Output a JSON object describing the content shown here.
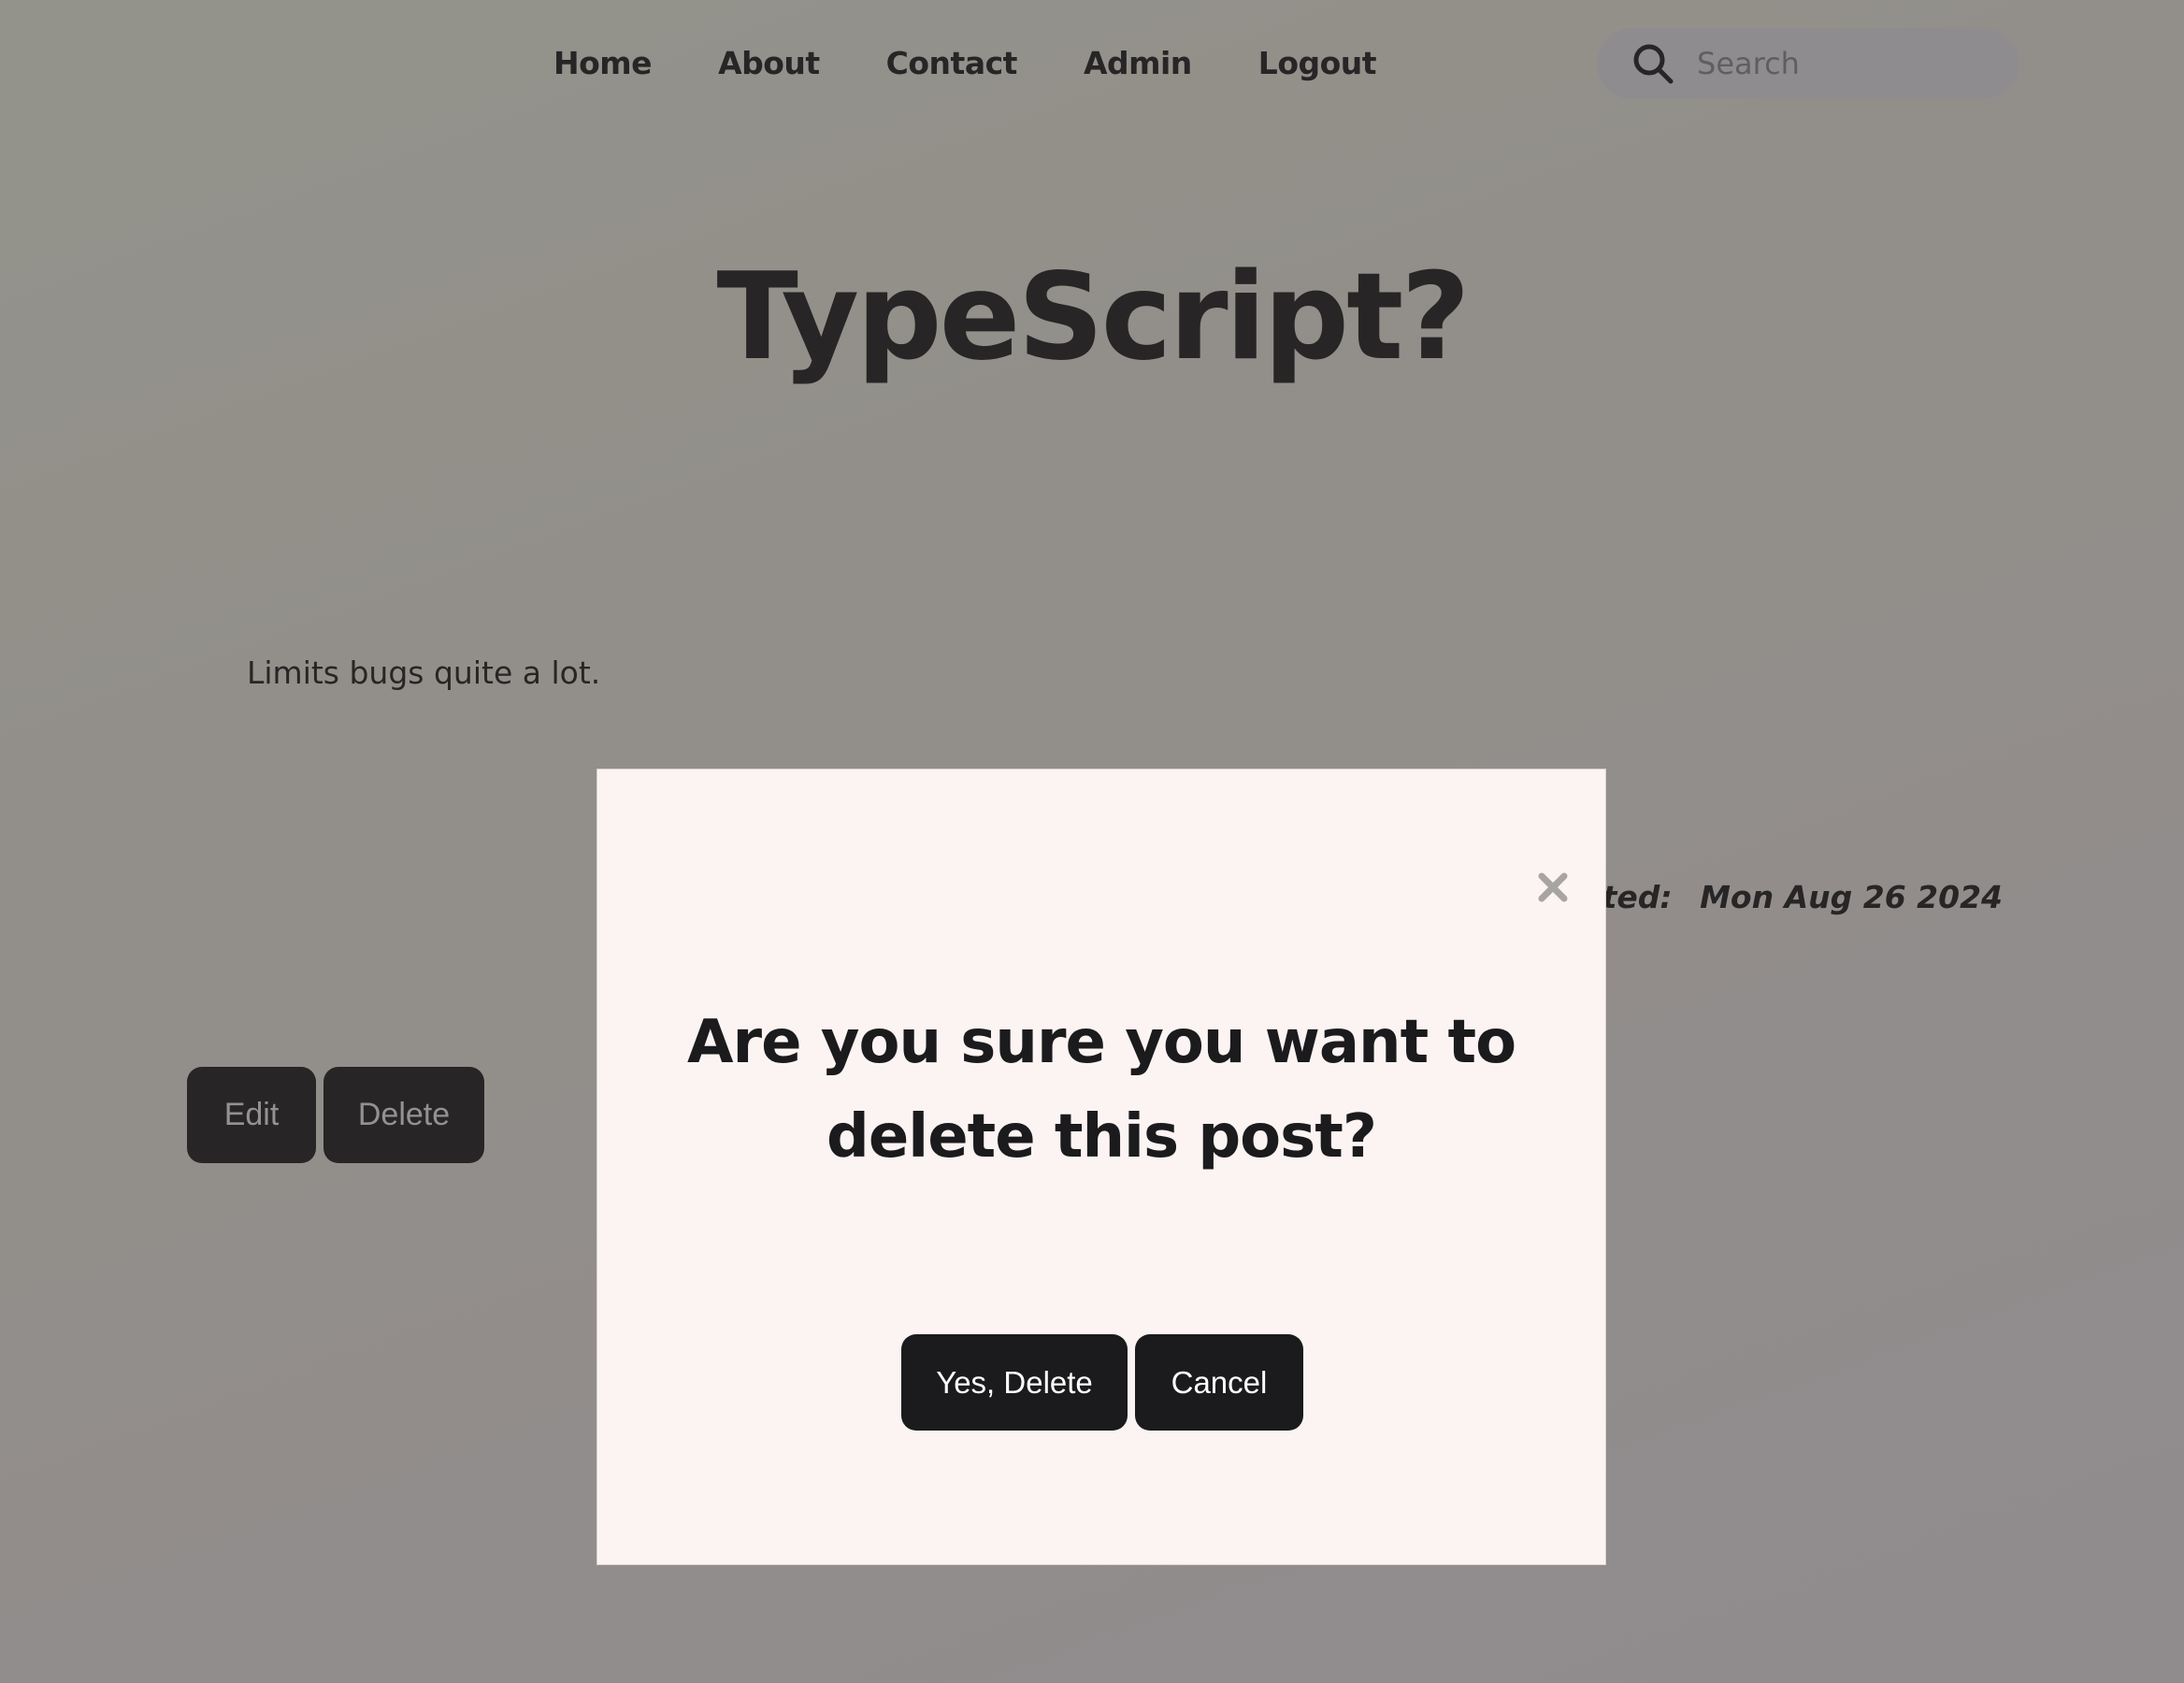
{
  "nav": {
    "items": [
      {
        "label": "Home"
      },
      {
        "label": "About"
      },
      {
        "label": "Contact"
      },
      {
        "label": "Admin"
      },
      {
        "label": "Logout"
      }
    ],
    "search_placeholder": "Search",
    "search_icon": "search-icon"
  },
  "post": {
    "title": "TypeScript?",
    "body": "Limits bugs quite a lot.",
    "meta_label": "Last edited:",
    "meta_date": "Mon Aug 26 2024",
    "edit_label": "Edit",
    "delete_label": "Delete"
  },
  "modal": {
    "question": "Are you sure you want to delete this post?",
    "confirm_label": "Yes, Delete",
    "cancel_label": "Cancel",
    "close_icon": "close-icon"
  },
  "colors": {
    "dark": "#1b1b1d",
    "modal_bg": "#fcf4f2",
    "search_bg": "#e8e8ee"
  }
}
